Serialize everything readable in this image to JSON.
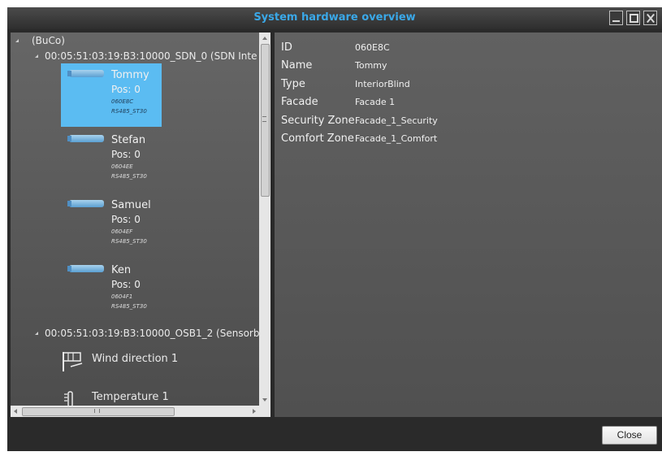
{
  "window": {
    "title": "System hardware overview",
    "accent_color": "#3aa8e8",
    "selection_color": "#5bbcf2"
  },
  "tree": {
    "root_label": "(BuCo)",
    "group_sdn_label": "00:05:51:03:19:B3:10000_SDN_0 (SDN Inte",
    "devices": [
      {
        "name": "Tommy",
        "pos": "Pos: 0",
        "id": "060E8C",
        "bus": "RS485_ST30",
        "selected": true,
        "icon": "blind-icon"
      },
      {
        "name": "Stefan",
        "pos": "Pos: 0",
        "id": "0604EE",
        "bus": "RS485_ST30",
        "selected": false,
        "icon": "blind-icon"
      },
      {
        "name": "Samuel",
        "pos": "Pos: 0",
        "id": "0604EF",
        "bus": "RS485_ST30",
        "selected": false,
        "icon": "blind-icon"
      },
      {
        "name": "Ken",
        "pos": "Pos: 0",
        "id": "0604F1",
        "bus": "RS485_ST30",
        "selected": false,
        "icon": "blind-icon"
      }
    ],
    "group_osb_label": "00:05:51:03:19:B3:10000_OSB1_2 (Sensorb",
    "sensors": [
      {
        "label": "Wind direction 1",
        "icon": "wind-direction-icon"
      },
      {
        "label": "Temperature 1",
        "icon": "thermometer-icon"
      }
    ]
  },
  "details": {
    "id_label": "ID",
    "id_value": "060E8C",
    "name_label": "Name",
    "name_value": "Tommy",
    "type_label": "Type",
    "type_value": "InteriorBlind",
    "facade_label": "Facade",
    "facade_value": "Facade 1",
    "security_label": "Security Zone",
    "security_value": "Facade_1_Security",
    "comfort_label": "Comfort Zone",
    "comfort_value": "Facade_1_Comfort"
  },
  "footer": {
    "close_label": "Close"
  }
}
